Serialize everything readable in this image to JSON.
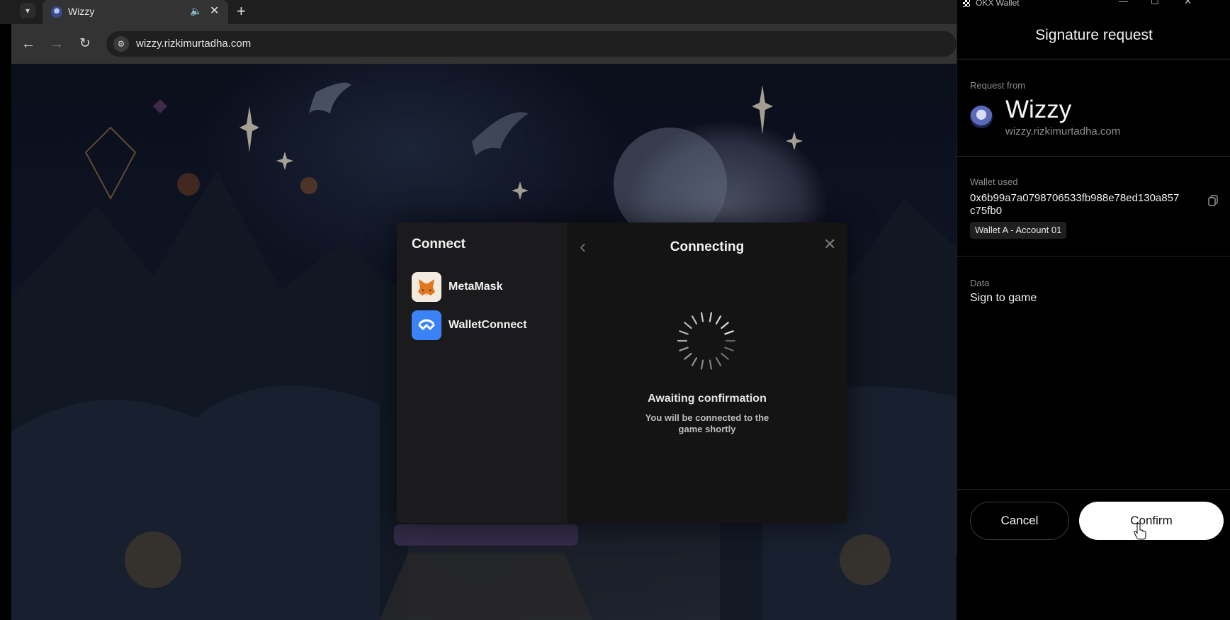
{
  "browser": {
    "tab_title": "Wizzy",
    "url": "wizzy.rizkimurtadha.com",
    "icons": {
      "tab_dropdown": "chevron-down-icon",
      "tab_audio": "speaker-icon",
      "tab_close": "close-icon",
      "new_tab": "plus-icon",
      "back": "arrow-left-icon",
      "forward": "arrow-right-icon",
      "reload": "reload-icon",
      "site_info": "tune-icon"
    }
  },
  "modal": {
    "connect_title": "Connect",
    "wallets": [
      {
        "label": "MetaMask",
        "icon": "metamask-fox-icon"
      },
      {
        "label": "WalletConnect",
        "icon": "walletconnect-icon"
      }
    ],
    "connecting_title": "Connecting",
    "awaiting_title": "Awaiting confirmation",
    "awaiting_subtitle": "You will be connected to the game shortly"
  },
  "okx": {
    "window_title": "OKX Wallet",
    "header_title": "Signature request",
    "request_from_label": "Request from",
    "requester_name": "Wizzy",
    "requester_domain": "wizzy.rizkimurtadha.com",
    "wallet_used_label": "Wallet used",
    "wallet_address": "0x6b99a7a0798706533fb988e78ed130a857c75fb0",
    "account_badge": "Wallet A - Account 01",
    "data_label": "Data",
    "data_value": "Sign to game",
    "cancel_label": "Cancel",
    "confirm_label": "Confirm"
  },
  "colors": {
    "modal_bg": "#1d1d1f",
    "okx_bg": "#000000",
    "confirm_bg": "#ffffff",
    "walletconnect_blue": "#3b82f6"
  }
}
